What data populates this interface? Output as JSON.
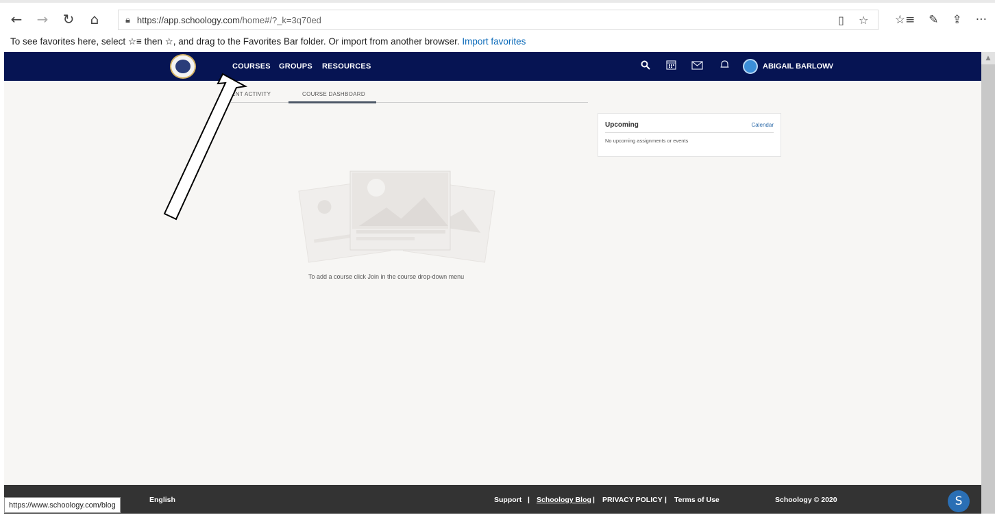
{
  "browser": {
    "back": "←",
    "forward": "→",
    "refresh": "↻",
    "home": "⌂",
    "lock": "🔒",
    "url_domain": "https://app.schoology.com",
    "url_path": "/home#/?_k=3q70ed",
    "reader": "▯",
    "favorite_star": "☆",
    "favorites_hub": "☆≡",
    "pen": "✎",
    "share": "⇪",
    "more": "···"
  },
  "favorites_bar": {
    "message": "To see favorites here, select ☆≡ then ☆, and drag to the Favorites Bar folder. Or import from another browser.",
    "import_link": "Import favorites"
  },
  "header": {
    "nav": [
      "COURSES",
      "GROUPS",
      "RESOURCES"
    ],
    "user_name": "ABIGAIL BARLOW",
    "chevron": "∨",
    "icons": [
      "search-icon",
      "calendar-icon",
      "mail-icon",
      "notifications-icon"
    ]
  },
  "tabs": {
    "recent": "ENT ACTIVITY",
    "dashboard": "COURSE DASHBOARD"
  },
  "upcoming": {
    "title": "Upcoming",
    "calendar_link": "Calendar",
    "empty": "No upcoming assignments or events"
  },
  "empty_state": {
    "message": "To add a course click Join in the course drop-down menu"
  },
  "footer": {
    "language": "English",
    "support": "Support",
    "sep": "|",
    "blog": "Schoology Blog",
    "privacy": "PRIVACY POLICY",
    "terms": "Terms of Use",
    "copyright": "Schoology © 2020"
  },
  "status_tooltip": "https://www.schoology.com/blog",
  "badge_letter": "S",
  "colors": {
    "header_bg": "#061453",
    "content_bg": "#f7f6f4",
    "footer_bg": "#333333",
    "link": "#2c6aa8"
  }
}
